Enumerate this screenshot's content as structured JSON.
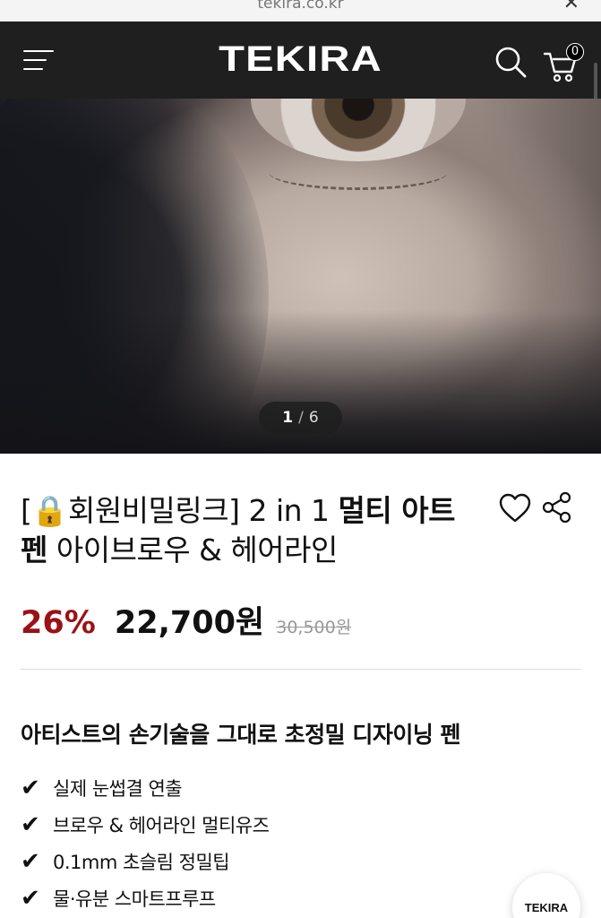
{
  "browser": {
    "url": "tekira.co.kr",
    "close_glyph": "✕"
  },
  "header": {
    "logo": "TEKIRA",
    "menu_icon": "hamburger-menu-icon",
    "search_icon": "search-icon",
    "cart_icon": "cart-icon",
    "cart_count": "0"
  },
  "gallery": {
    "current": "1",
    "separator": "/",
    "total": "6"
  },
  "product": {
    "title_prefix": "[🔒회원비밀링크] 2 in 1 ",
    "title_bold": "멀티 아트 펜",
    "title_suffix": " 아이브로우 & 헤어라인",
    "discount": "26%",
    "price": "22,700원",
    "original_price": "30,500원"
  },
  "description": {
    "headline": "아티스트의 손기술을 그대로 초정밀 디자이닝 펜",
    "check_glyph": "✔",
    "features": [
      "실제 눈썹결 연출",
      "브로우 & 헤어라인 멀티유즈",
      "0.1mm 초슬림 정밀팁",
      "물·유분 스마트프루프"
    ]
  },
  "floating_button": {
    "label": "TEKIRA"
  },
  "colors": {
    "header_bg": "#1f1f1f",
    "discount": "#9a1215",
    "text": "#111111"
  }
}
